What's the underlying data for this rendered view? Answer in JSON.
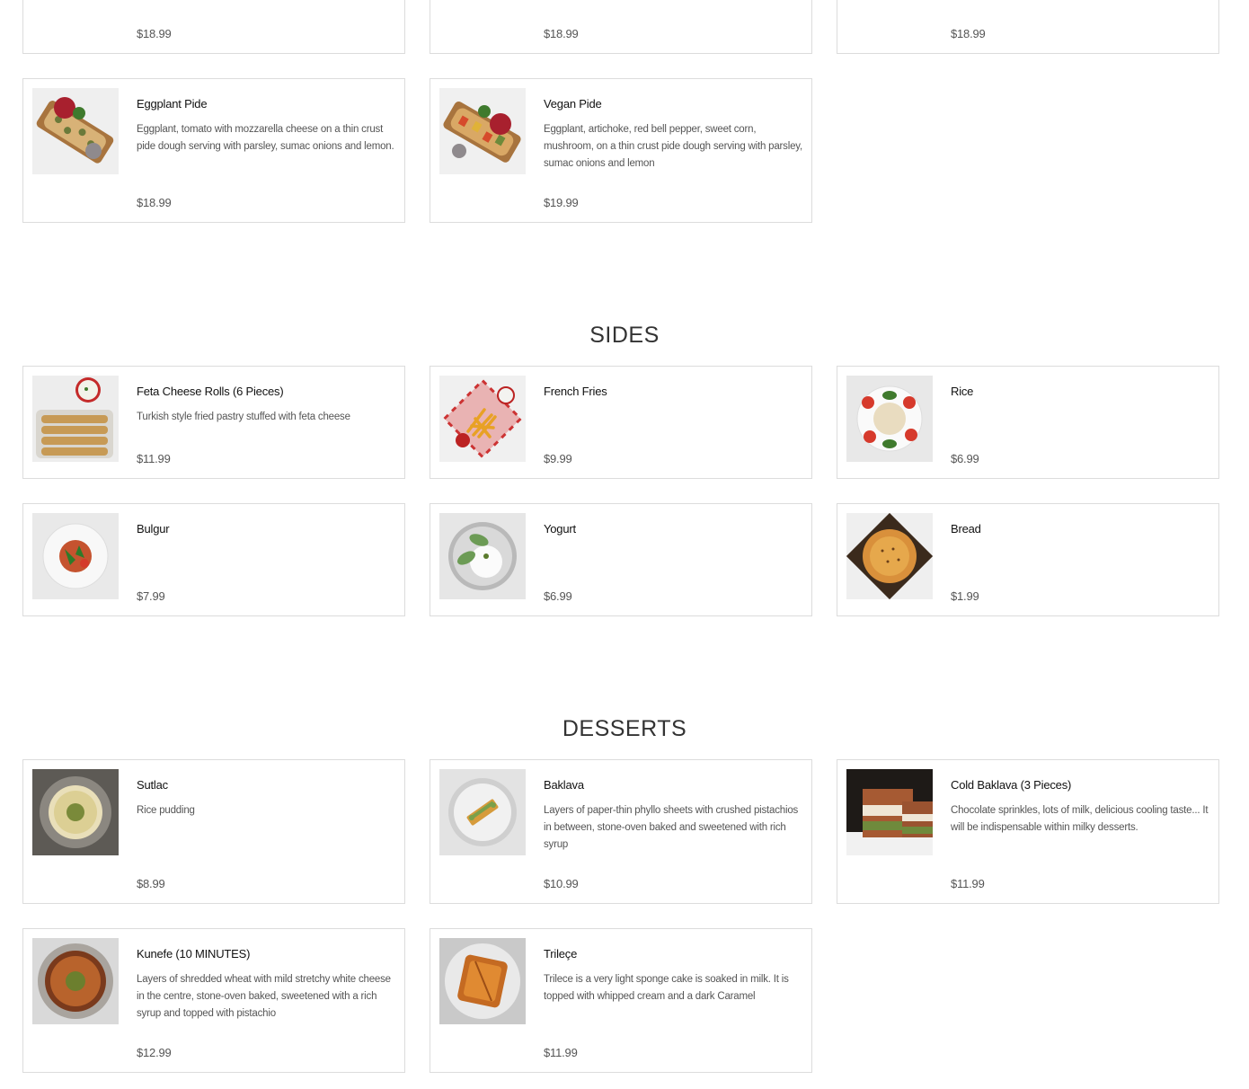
{
  "top_row": {
    "items": [
      {
        "price": "$18.99"
      },
      {
        "price": "$18.99"
      },
      {
        "price": "$18.99"
      }
    ]
  },
  "pides": {
    "items": [
      {
        "name": "Eggplant Pide",
        "desc": "Eggplant, tomato with mozzarella cheese on a thin crust pide dough serving with parsley, sumac onions and lemon.",
        "price": "$18.99"
      },
      {
        "name": "Vegan Pide",
        "desc": "Eggplant, artichoke, red bell pepper, sweet corn, mushroom, on a thin crust pide dough serving with parsley, sumac onions and lemon",
        "price": "$19.99"
      }
    ]
  },
  "sides": {
    "title": "SIDES",
    "items": [
      {
        "name": "Feta Cheese Rolls (6 Pieces)",
        "desc": "Turkish style fried pastry stuffed with feta cheese",
        "price": "$11.99"
      },
      {
        "name": "French Fries",
        "desc": "",
        "price": "$9.99"
      },
      {
        "name": "Rice",
        "desc": "",
        "price": "$6.99"
      },
      {
        "name": "Bulgur",
        "desc": "",
        "price": "$7.99"
      },
      {
        "name": "Yogurt",
        "desc": "",
        "price": "$6.99"
      },
      {
        "name": "Bread",
        "desc": "",
        "price": "$1.99"
      }
    ]
  },
  "desserts": {
    "title": "DESSERTS",
    "items": [
      {
        "name": "Sutlac",
        "desc": "Rice pudding",
        "price": "$8.99"
      },
      {
        "name": "Baklava",
        "desc": "Layers of paper-thin phyllo sheets with crushed pistachios in between, stone-oven baked and sweetened with rich syrup",
        "price": "$10.99"
      },
      {
        "name": "Cold Baklava (3 Pieces)",
        "desc": "Chocolate sprinkles, lots of milk, delicious cooling taste... It will be indispensable within milky desserts.",
        "price": "$11.99"
      },
      {
        "name": "Kunefe (10 MINUTES)",
        "desc": "Layers of shredded wheat with mild stretchy white cheese in the centre, stone-oven baked, sweetened with a rich syrup and topped with pistachio",
        "price": "$12.99"
      },
      {
        "name": "Trileçe",
        "desc": "Trilece is a very light sponge cake is soaked in milk. It is topped with whipped cream and a dark Caramel",
        "price": "$11.99"
      }
    ]
  }
}
